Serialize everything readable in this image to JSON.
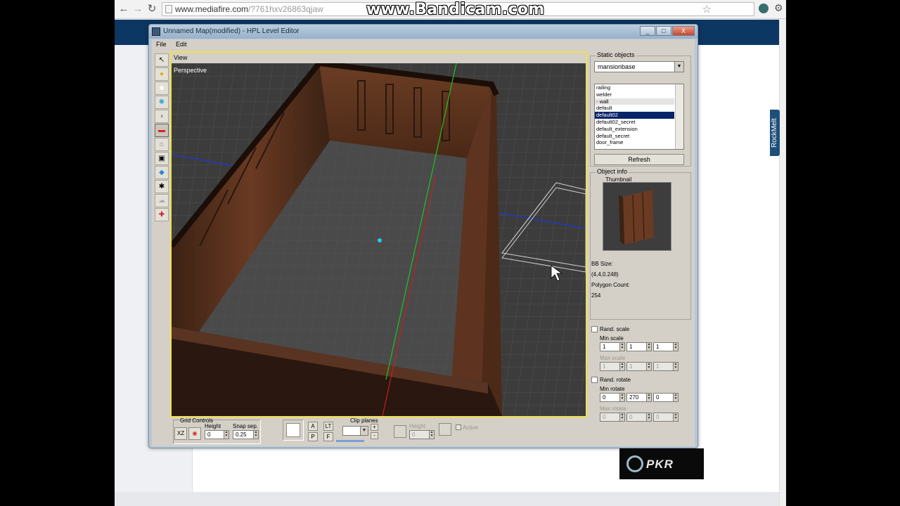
{
  "browser": {
    "back": "←",
    "forward": "→",
    "reload": "↻",
    "url_host": "www.mediafire.com",
    "url_path": "/?761hxv26863qjaw",
    "watermark": "www.Bandicam.com"
  },
  "sidebar_tab": "RockMelt",
  "editor": {
    "title": "Unnamed Map(modified) - HPL Level Editor",
    "window_buttons": [
      "_",
      "□",
      "X"
    ],
    "menu": [
      "File",
      "Edit"
    ],
    "view_label": "View",
    "viewport_label": "Perspective",
    "grid_controls": {
      "title": "Grid Controls",
      "plane": "XZ",
      "height_label": "Height",
      "height_value": "0",
      "snap_label": "Snap sep.",
      "snap_value": "0.25"
    },
    "view_buttons": [
      "A",
      "LT",
      "P",
      "F"
    ],
    "clip_planes": {
      "title": "Clip planes",
      "add": "+",
      "remove": "-",
      "height_label": "Height",
      "height_value": "0",
      "active_label": "Active"
    },
    "static_objects": {
      "title": "Static objects",
      "category": "mansionbase",
      "items": [
        "railing",
        "welder",
        "- wall",
        "default",
        "default02",
        "default02_secret",
        "default_extension",
        "default_secret",
        "door_frame"
      ],
      "selected_index": 4,
      "refresh_label": "Refresh"
    },
    "object_info": {
      "title": "Object info",
      "thumbnail_label": "Thumbnail",
      "bb_size_label": "BB Size:",
      "bb_size_value": "(4,4,0.248)",
      "polygon_label": "Polygon Count:",
      "polygon_value": "254"
    },
    "rand_scale": {
      "label": "Rand. scale",
      "min_label": "Min scale",
      "min_values": [
        "1",
        "1",
        "1"
      ],
      "max_label": "Max scale",
      "max_values": [
        "1",
        "1",
        "1"
      ]
    },
    "rand_rotate": {
      "label": "Rand. rotate",
      "min_label": "Min rotate",
      "min_values": [
        "0",
        "270",
        "0"
      ],
      "max_label": "Max rotate",
      "max_values": [
        "0",
        "0",
        "0"
      ]
    }
  },
  "pkr": "PKR"
}
